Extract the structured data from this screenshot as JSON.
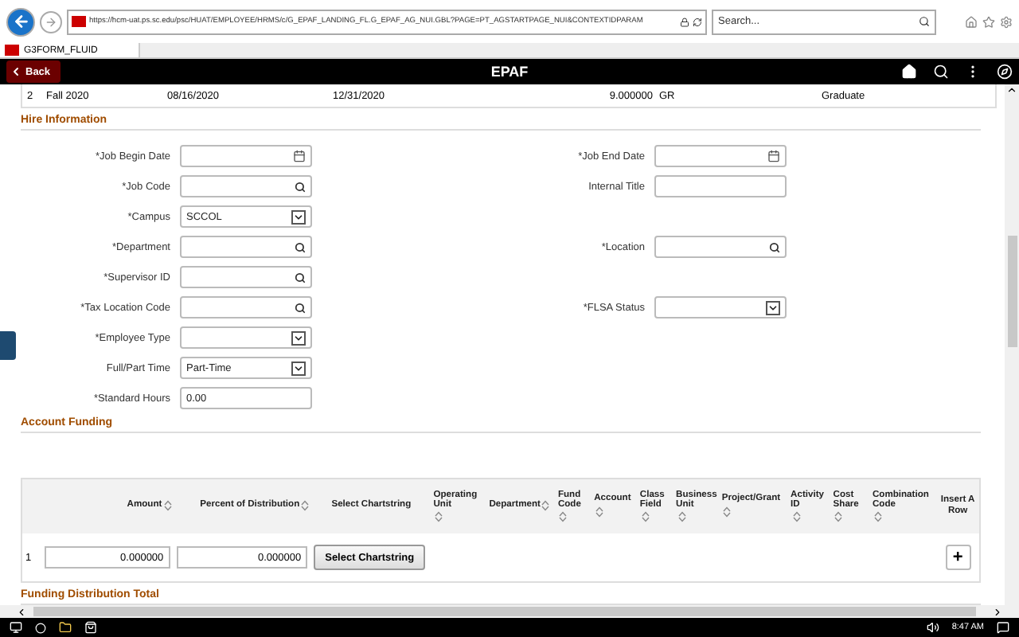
{
  "browser": {
    "url": "https://hcm-uat.ps.sc.edu/psc/HUAT/EMPLOYEE/HRMS/c/G_EPAF_LANDING_FL.G_EPAF_AG_NUI.GBL?PAGE=PT_AGSTARTPAGE_NUI&CONTEXTIDPARAM",
    "search_placeholder": "Search...",
    "tab_title": "G3FORM_FLUID"
  },
  "header": {
    "back_label": "Back",
    "title": "EPAF"
  },
  "prior_row": [
    "2",
    "Fall 2020",
    "08/16/2020",
    "12/31/2020",
    "9.000000",
    "GR",
    "Graduate"
  ],
  "hire_information": {
    "title": "Hire Information",
    "rows": [
      {
        "left": {
          "label": "*Job Begin Date",
          "kind": "date"
        },
        "right": {
          "label": "*Job End Date",
          "kind": "date"
        }
      },
      {
        "left": {
          "label": "*Job Code",
          "kind": "lookup"
        },
        "right": {
          "label": "Internal Title",
          "kind": "text"
        }
      },
      {
        "left": {
          "label": "*Campus",
          "kind": "select",
          "value": "SCCOL"
        },
        "right": null
      },
      {
        "left": {
          "label": "*Department",
          "kind": "lookup"
        },
        "right": {
          "label": "*Location",
          "kind": "lookup"
        }
      },
      {
        "left": {
          "label": "*Supervisor ID",
          "kind": "lookup"
        },
        "right": null
      },
      {
        "left": {
          "label": "*Tax Location Code",
          "kind": "lookup"
        },
        "right": {
          "label": "*FLSA Status",
          "kind": "select"
        }
      },
      {
        "left": {
          "label": "*Employee Type",
          "kind": "select"
        },
        "right": null
      },
      {
        "left": {
          "label": "Full/Part Time",
          "kind": "select",
          "value": "Part-Time"
        },
        "right": null
      },
      {
        "left": {
          "label": "*Standard Hours",
          "kind": "text",
          "value": "0.00"
        },
        "right": null
      }
    ]
  },
  "account_funding": {
    "title": "Account Funding",
    "columns": [
      {
        "label": "Amount",
        "sortable": true
      },
      {
        "label": "Percent of Distribution",
        "sortable": true
      },
      {
        "label": "Select Chartstring",
        "sortable": false
      },
      {
        "label": "Operating Unit",
        "sortable": true
      },
      {
        "label": "Department",
        "sortable": true
      },
      {
        "label": "Fund Code",
        "sortable": true
      },
      {
        "label": "Account",
        "sortable": true
      },
      {
        "label": "Class Field",
        "sortable": true
      },
      {
        "label": "Business Unit",
        "sortable": true
      },
      {
        "label": "Project/Grant",
        "sortable": true
      },
      {
        "label": "Activity ID",
        "sortable": true
      },
      {
        "label": "Cost Share",
        "sortable": true
      },
      {
        "label": "Combination Code",
        "sortable": true
      },
      {
        "label": "Insert A Row",
        "sortable": false
      }
    ],
    "rows": [
      {
        "number": "1",
        "amount": "0.000000",
        "percent": "0.000000",
        "button": "Select Chartstring",
        "insert": "+"
      }
    ]
  },
  "funding_total": {
    "title": "Funding Distribution Total"
  },
  "taskbar": {
    "time": "8:47 AM"
  }
}
